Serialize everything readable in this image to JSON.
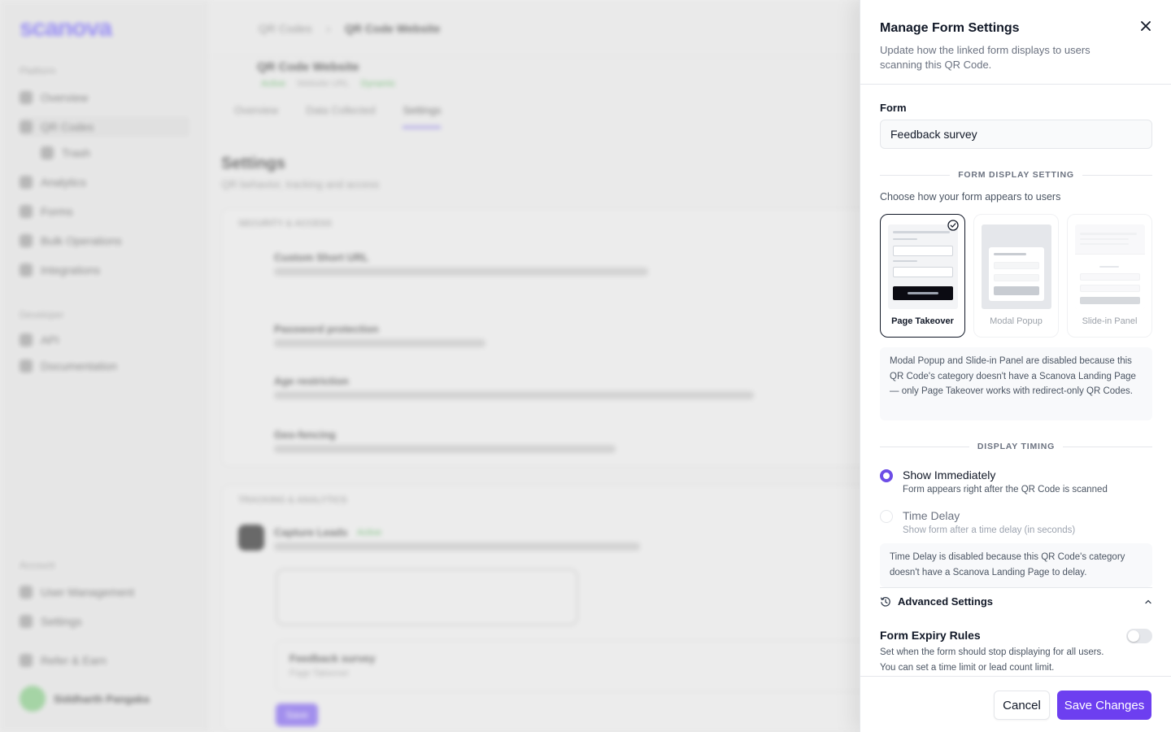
{
  "background": {
    "logo": "scanova",
    "sections": [
      "Platform",
      "Developer",
      "Account"
    ],
    "nav": [
      "Overview",
      "QR Codes",
      "Trash",
      "Analytics",
      "Forms",
      "Bulk Operations",
      "Integrations",
      "API",
      "Documentation",
      "User Management",
      "Settings",
      "Refer & Earn"
    ],
    "user_name": "Siddharth Pangaka",
    "breadcrumb": [
      "QR Codes",
      "QR Code Website"
    ],
    "qr_title": "QR Code Website",
    "badges": [
      "Active",
      "Website URL",
      "Dynamic"
    ],
    "tabs": [
      "Overview",
      "Data Collected",
      "Settings"
    ],
    "page_title": "Settings",
    "page_subtitle": "QR behavior, tracking and access",
    "card1_heading": "SECURITY & ACCESS",
    "card1_items": [
      "Custom Short URL",
      "Password protection",
      "Age restriction",
      "Geo-fencing"
    ],
    "card2_heading": "TRACKING & ANALYTICS",
    "card2_item": "Capture Leads",
    "card2_item_badge": "Active",
    "form_card_title": "Feedback survey",
    "form_card_sub": "Page Takeover",
    "form_card_button": "Save"
  },
  "drawer": {
    "title": "Manage Form Settings",
    "description": "Update how the linked form displays to users scanning this QR Code.",
    "form_label": "Form",
    "form_value": "Feedback survey",
    "display_setting_heading": "FORM DISPLAY SETTING",
    "display_setting_hint": "Choose how your form appears to users",
    "options": [
      {
        "label": "Page Takeover",
        "selected": true
      },
      {
        "label": "Modal Popup",
        "selected": false
      },
      {
        "label": "Slide-in Panel",
        "selected": false
      }
    ],
    "display_info": "Modal Popup and Slide-in Panel are disabled because this QR Code's category doesn't have a Scanova Landing Page — only Page Takeover works with redirect-only QR Codes.",
    "timing_heading": "DISPLAY TIMING",
    "timing_options": [
      {
        "title": "Show Immediately",
        "subtitle": "Form appears right after the QR Code is scanned",
        "selected": true
      },
      {
        "title": "Time Delay",
        "subtitle": "Show form after a time delay (in seconds)",
        "selected": false
      }
    ],
    "timing_info": "Time Delay is disabled because this QR Code's category doesn't have a Scanova Landing Page to delay.",
    "advanced_label": "Advanced Settings",
    "expiry_title": "Form Expiry Rules",
    "expiry_desc": "Set when the form should stop displaying for all users. You can set a time limit or lead count limit.",
    "expiry_enabled": false,
    "cancel_label": "Cancel",
    "save_label": "Save Changes"
  },
  "colors": {
    "accent": "#6d3ff0",
    "selected_border": "#111827"
  }
}
